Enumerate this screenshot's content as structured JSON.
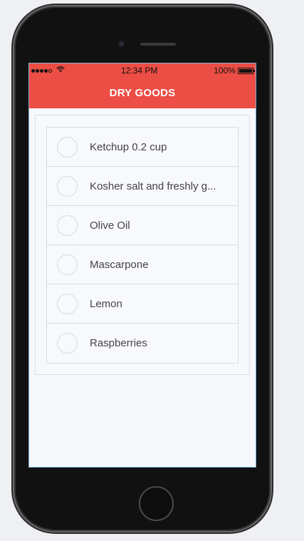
{
  "status_bar": {
    "time": "12:34 PM",
    "battery": "100%",
    "signal_bars": 4,
    "signal_total": 5
  },
  "header": {
    "title": "DRY GOODS",
    "color": "#ec4d44"
  },
  "list": {
    "items": [
      {
        "label": "Ketchup 0.2 cup"
      },
      {
        "label": "Kosher salt and freshly g..."
      },
      {
        "label": "Olive Oil"
      },
      {
        "label": "Mascarpone"
      },
      {
        "label": "Lemon"
      },
      {
        "label": "Raspberries"
      }
    ]
  },
  "icons": {
    "wifi": "wifi-icon",
    "battery": "battery-icon",
    "signal": "signal-dots-icon"
  }
}
